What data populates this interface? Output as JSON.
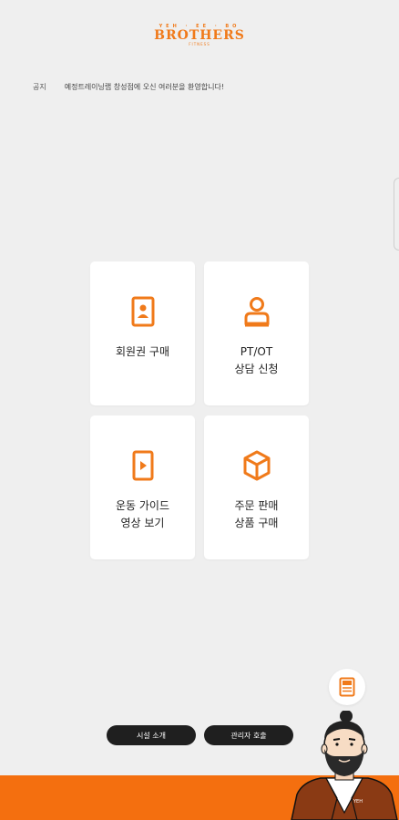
{
  "logo": {
    "top": "YEH · EE · BO",
    "main": "BROTHERS",
    "sub": "FITNESS"
  },
  "notice": {
    "label": "공지",
    "text": "예정트레이닝랩 창성점에 오신 여러분을 환영합니다!"
  },
  "menu": [
    {
      "label": "회원권 구매",
      "icon": "member-card-icon"
    },
    {
      "label": "PT/OT\n상담 신청",
      "icon": "person-icon"
    },
    {
      "label": "운동 가이드\n영상 보기",
      "icon": "video-play-icon"
    },
    {
      "label": "주문 판매\n상품 구매",
      "icon": "box-icon"
    }
  ],
  "buttons": {
    "intro": "시설 소개",
    "admin": "관리자 호출"
  },
  "colors": {
    "accent": "#f46f0f",
    "background": "#efefef",
    "pill": "#1f1f1f"
  },
  "character": {
    "shirt_text": "YEH"
  }
}
